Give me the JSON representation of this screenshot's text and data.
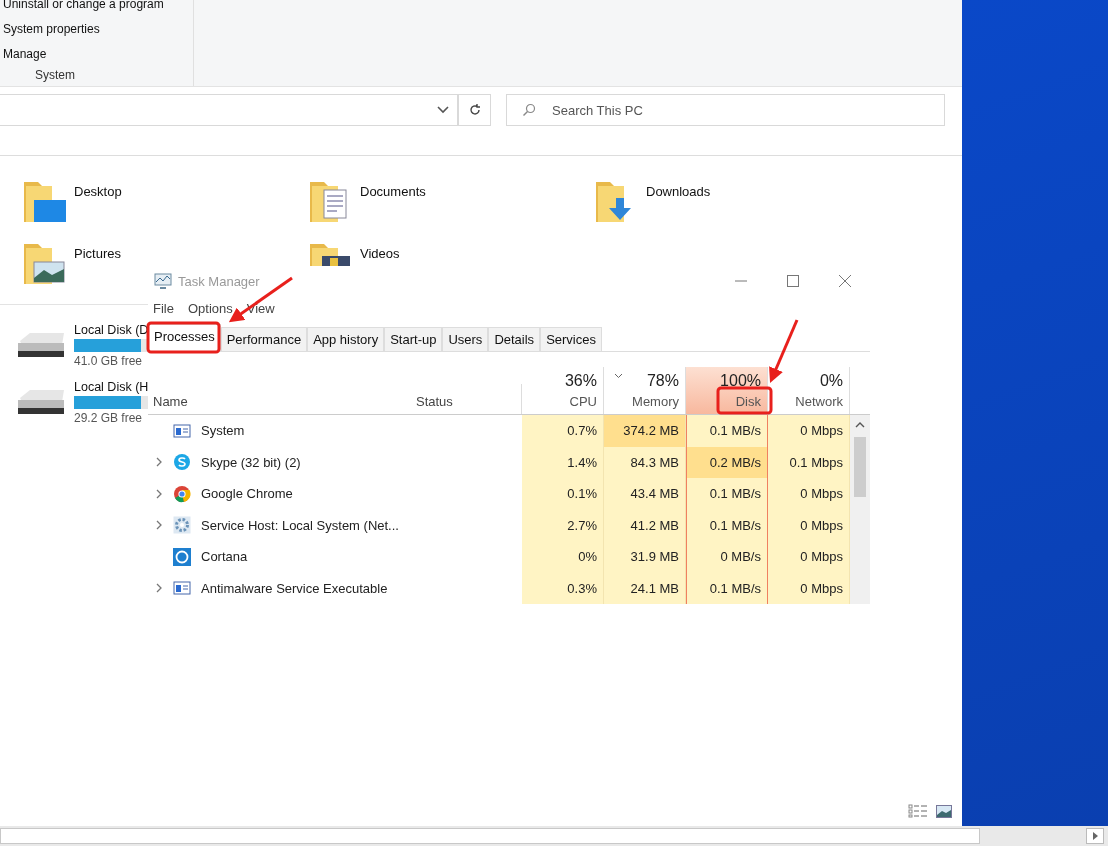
{
  "ribbon": {
    "links": [
      "Uninstall or change a program",
      "System properties",
      "Manage"
    ],
    "group_label": "System"
  },
  "address_bar": {
    "search": {
      "placeholder": "Search This PC"
    }
  },
  "folders": [
    {
      "name": "Desktop",
      "kind": "desktop"
    },
    {
      "name": "Documents",
      "kind": "documents"
    },
    {
      "name": "Downloads",
      "kind": "downloads"
    },
    {
      "name": "Pictures",
      "kind": "pictures"
    },
    {
      "name": "Videos",
      "kind": "videos"
    }
  ],
  "drives": [
    {
      "name": "Local Disk (D",
      "free": "41.0 GB free",
      "level": 0.9
    },
    {
      "name": "Local Disk (H",
      "free": "29.2 GB free",
      "level": 0.9
    }
  ],
  "task_manager": {
    "title": "Task Manager",
    "menu": [
      "File",
      "Options",
      "View"
    ],
    "tabs": [
      {
        "label": "Processes",
        "selected": true
      },
      {
        "label": "Performance",
        "selected": false
      },
      {
        "label": "App history",
        "selected": false
      },
      {
        "label": "Start-up",
        "selected": false
      },
      {
        "label": "Users",
        "selected": false
      },
      {
        "label": "Details",
        "selected": false
      },
      {
        "label": "Services",
        "selected": false
      }
    ],
    "columns": {
      "name": "Name",
      "status": "Status",
      "metrics": [
        {
          "percent": "36%",
          "label": "CPU",
          "sorted": false,
          "alert": false
        },
        {
          "percent": "78%",
          "label": "Memory",
          "sorted": true,
          "alert": false
        },
        {
          "percent": "100%",
          "label": "Disk",
          "sorted": false,
          "alert": true
        },
        {
          "percent": "0%",
          "label": "Network",
          "sorted": false,
          "alert": false
        }
      ]
    },
    "rows": [
      {
        "name": "System",
        "kind": "window",
        "expandable": false,
        "cells": [
          {
            "value": "0.7%",
            "high": false
          },
          {
            "value": "374.2 MB",
            "high": true
          },
          {
            "value": "0.1 MB/s",
            "high": false
          },
          {
            "value": "0 Mbps",
            "high": false
          }
        ]
      },
      {
        "name": "Skype (32 bit) (2)",
        "kind": "skype",
        "expandable": true,
        "cells": [
          {
            "value": "1.4%",
            "high": false
          },
          {
            "value": "84.3 MB",
            "high": false
          },
          {
            "value": "0.2 MB/s",
            "high": true
          },
          {
            "value": "0.1 Mbps",
            "high": false
          }
        ]
      },
      {
        "name": "Google Chrome",
        "kind": "chrome",
        "expandable": true,
        "cells": [
          {
            "value": "0.1%",
            "high": false
          },
          {
            "value": "43.4 MB",
            "high": false
          },
          {
            "value": "0.1 MB/s",
            "high": false
          },
          {
            "value": "0 Mbps",
            "high": false
          }
        ]
      },
      {
        "name": "Service Host: Local System (Net...",
        "kind": "gear",
        "expandable": true,
        "cells": [
          {
            "value": "2.7%",
            "high": false
          },
          {
            "value": "41.2 MB",
            "high": false
          },
          {
            "value": "0.1 MB/s",
            "high": false
          },
          {
            "value": "0 Mbps",
            "high": false
          }
        ]
      },
      {
        "name": "Cortana",
        "kind": "ring",
        "expandable": false,
        "cells": [
          {
            "value": "0%",
            "high": false
          },
          {
            "value": "31.9 MB",
            "high": false
          },
          {
            "value": "0 MB/s",
            "high": false
          },
          {
            "value": "0 Mbps",
            "high": false
          }
        ]
      },
      {
        "name": "Antimalware Service Executable",
        "kind": "window",
        "expandable": true,
        "cells": [
          {
            "value": "0.3%",
            "high": false
          },
          {
            "value": "24.1 MB",
            "high": false
          },
          {
            "value": "0.1 MB/s",
            "high": false
          },
          {
            "value": "0 Mbps",
            "high": false
          }
        ]
      }
    ]
  }
}
